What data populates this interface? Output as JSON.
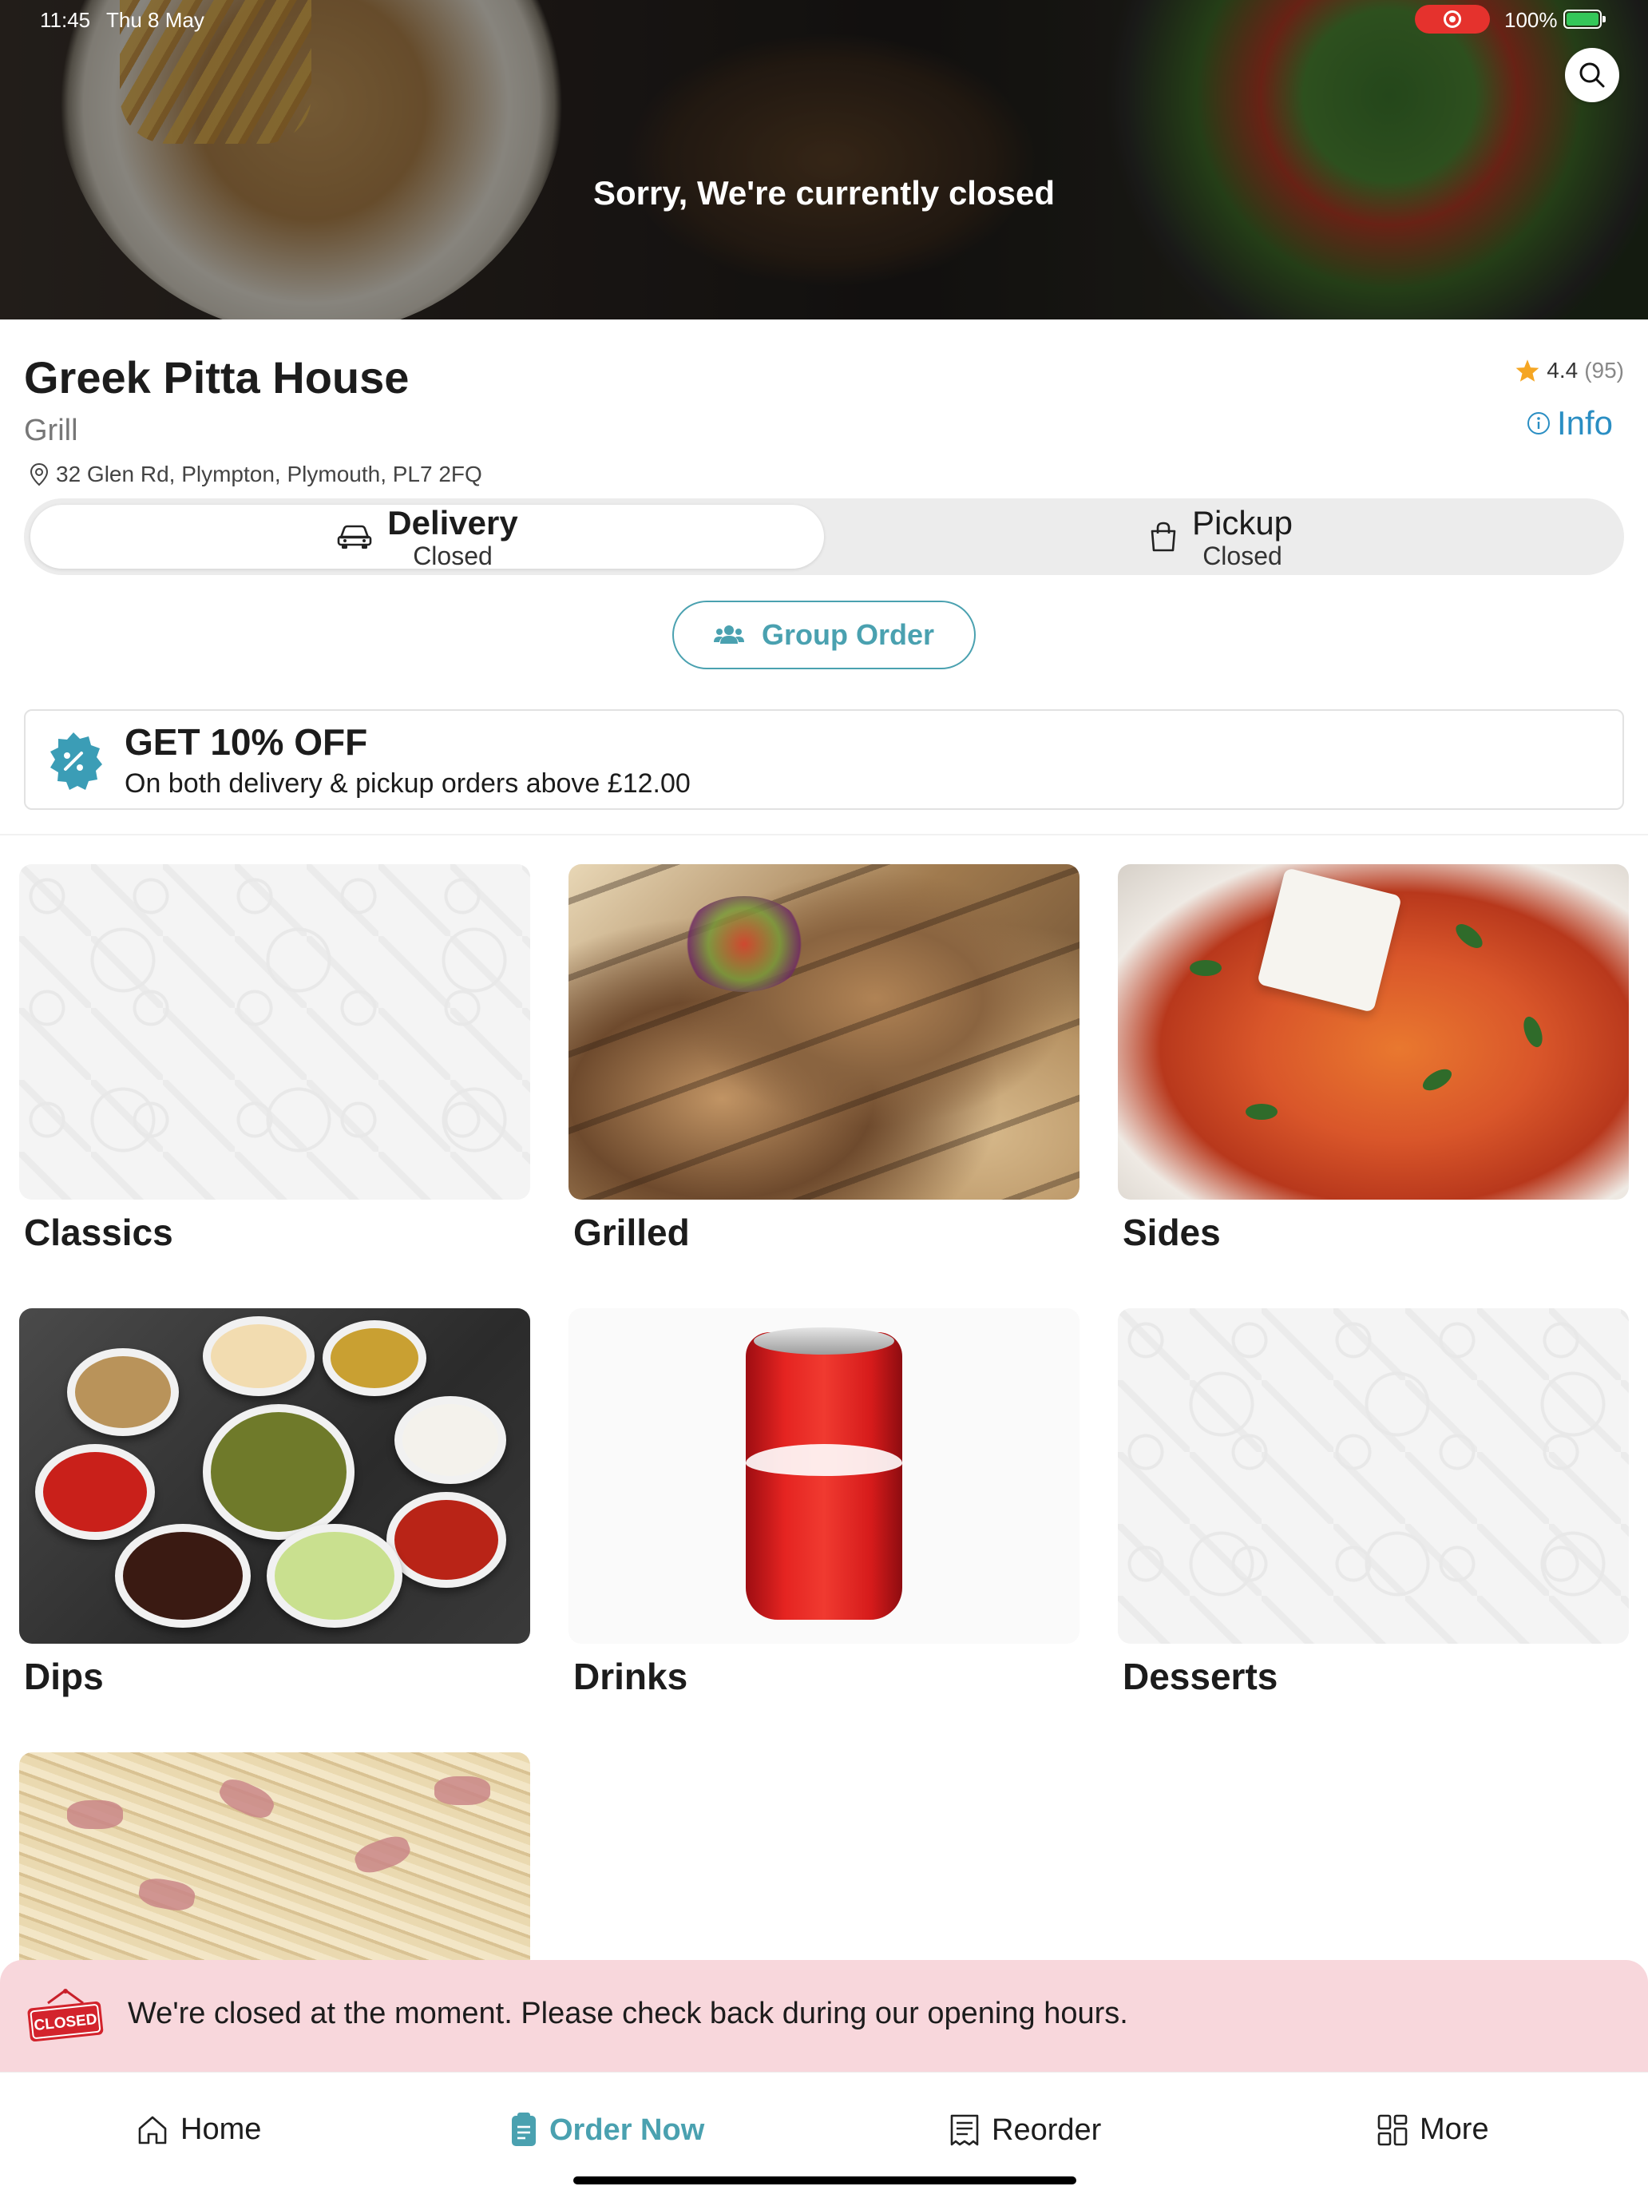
{
  "status_bar": {
    "time": "11:45",
    "date": "Thu 8 May",
    "battery": "100%"
  },
  "hero": {
    "closed_message": "Sorry, We're currently closed",
    "search_icon": "search-icon"
  },
  "restaurant": {
    "name": "Greek Pitta House",
    "category": "Grill",
    "address": "32 Glen Rd, Plympton, Plymouth, PL7 2FQ",
    "rating": "4.4",
    "rating_count": "(95)",
    "info_label": "Info"
  },
  "order_mode": {
    "selected": "Delivery",
    "options": [
      {
        "label": "Delivery",
        "status": "Closed",
        "icon": "car-icon"
      },
      {
        "label": "Pickup",
        "status": "Closed",
        "icon": "shopping-bag-icon"
      }
    ]
  },
  "group_order": {
    "label": "Group Order",
    "icon": "people-icon"
  },
  "promo": {
    "title": "GET 10% OFF",
    "description": "On both delivery & pickup orders above £12.00",
    "icon": "percent-badge-icon"
  },
  "categories": [
    {
      "name": "Classics"
    },
    {
      "name": "Grilled"
    },
    {
      "name": "Sides"
    },
    {
      "name": "Dips"
    },
    {
      "name": "Drinks"
    },
    {
      "name": "Desserts"
    },
    {
      "name": ""
    }
  ],
  "closed_banner": {
    "sign_text": "CLOSED",
    "message": "We're closed at the moment. Please check back during our opening hours."
  },
  "bottom_nav": {
    "active": "Order Now",
    "items": [
      {
        "label": "Home",
        "icon": "home-icon"
      },
      {
        "label": "Order Now",
        "icon": "menu-book-icon"
      },
      {
        "label": "Reorder",
        "icon": "receipt-icon"
      },
      {
        "label": "More",
        "icon": "grid-icon"
      }
    ]
  },
  "colors": {
    "accent": "#4aa1b0",
    "info_link": "#2a8ec3",
    "closed_banner_bg": "#f8d7dc",
    "star": "#f5a623"
  }
}
